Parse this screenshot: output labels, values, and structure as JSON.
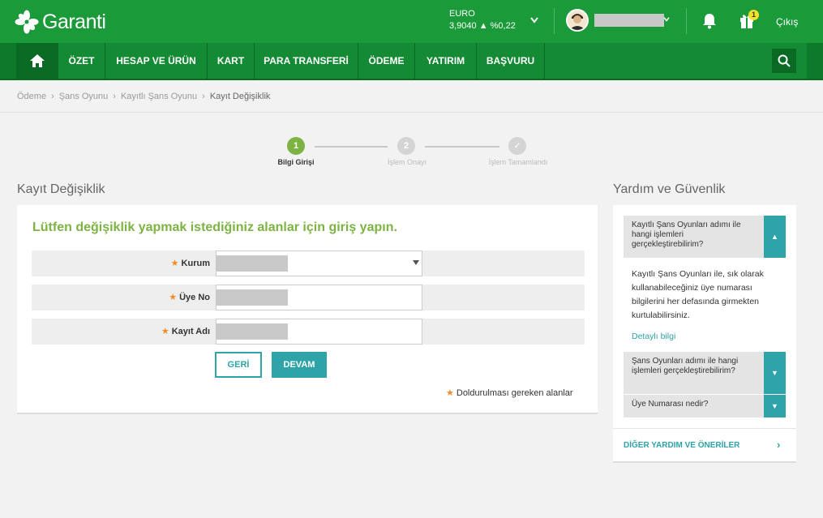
{
  "header": {
    "logo_text": "Garanti",
    "currency": {
      "name": "EURO",
      "value": "3,9040 ▲ %0,22"
    },
    "notification_count": "1",
    "logout_label": "Çıkış"
  },
  "nav": {
    "items": [
      "ÖZET",
      "HESAP VE ÜRÜN",
      "KART",
      "PARA TRANSFERİ",
      "ÖDEME",
      "YATIRIM",
      "BAŞVURU"
    ]
  },
  "breadcrumb": [
    "Ödeme",
    "Şans Oyunu",
    "Kayıtlı Şans Oyunu",
    "Kayıt Değişiklik"
  ],
  "stepper": {
    "steps": [
      {
        "number": "1",
        "label": "Bilgi Girişi",
        "state": "active"
      },
      {
        "number": "2",
        "label": "İşlem Onayı",
        "state": "pending"
      },
      {
        "number": "✓",
        "label": "İşlem Tamamlandı",
        "state": "pending"
      }
    ]
  },
  "form": {
    "section_title": "Kayıt Değişiklik",
    "heading": "Lütfen değişiklik yapmak istediğiniz alanlar için giriş yapın.",
    "fields": [
      {
        "label": "Kurum",
        "type": "select"
      },
      {
        "label": "Üye No",
        "type": "text"
      },
      {
        "label": "Kayıt Adı",
        "type": "text"
      }
    ],
    "back_label": "GERİ",
    "next_label": "DEVAM",
    "required_note": "Doldurulması gereken alanlar"
  },
  "help": {
    "section_title": "Yardım ve Güvenlik",
    "faq": [
      {
        "question": "Kayıtlı Şans Oyunları adımı ile hangi işlemleri gerçekleştirebilirim?",
        "expanded": true,
        "answer": "Kayıtlı Şans Oyunları ile, sık olarak kullanabileceğiniz üye numarası bilgilerini her defasında girmekten kurtulabilirsiniz.",
        "link": "Detaylı bilgi"
      },
      {
        "question": "Şans Oyunları adımı ile hangi işlemleri gerçekleştirebilirim?",
        "expanded": false
      },
      {
        "question": "Üye Numarası nedir?",
        "expanded": false
      }
    ],
    "more_label": "DİĞER YARDIM VE ÖNERİLER"
  },
  "colors": {
    "header_green": "#1b9a3a",
    "nav_green": "#148a34",
    "accent_teal": "#2ea3a8",
    "heading_green": "#7cb342",
    "step_active": "#7cb342",
    "step_pending": "#d4d4d4",
    "required_star": "#f28c28"
  }
}
